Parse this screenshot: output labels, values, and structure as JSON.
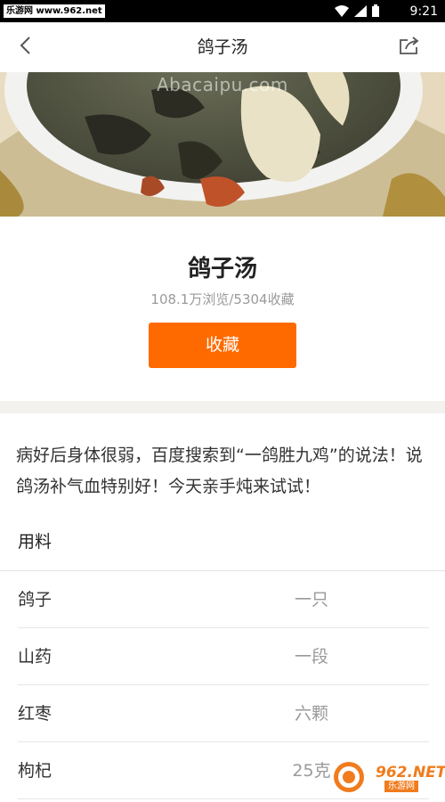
{
  "status_bar": {
    "carrier_badge": "乐游网 www.962.net",
    "time": "9:21",
    "icons": [
      "wifi-icon",
      "signal-icon",
      "battery-icon"
    ]
  },
  "nav": {
    "title": "鸽子汤",
    "back_icon": "chevron-left-icon",
    "share_icon": "share-icon"
  },
  "hero": {
    "watermark": "Abacaipu.com"
  },
  "recipe": {
    "title": "鸽子汤",
    "stats": "108.1万浏览/5304收藏",
    "favorite_label": "收藏",
    "description": "病好后身体很弱，百度搜索到“一鸽胜九鸡”的说法！说鸽汤补气血特别好！今天亲手炖来试试！"
  },
  "ingredients": {
    "header": "用料",
    "items": [
      {
        "name": "鸽子",
        "qty": "一只"
      },
      {
        "name": "山药",
        "qty": "一段"
      },
      {
        "name": "红枣",
        "qty": "六颗"
      },
      {
        "name": "枸杞",
        "qty": "25克"
      }
    ]
  },
  "site_watermark": {
    "domain": "962.NET",
    "sub": "乐游网"
  },
  "colors": {
    "accent": "#ff6a00",
    "status_bar": "#000000"
  }
}
